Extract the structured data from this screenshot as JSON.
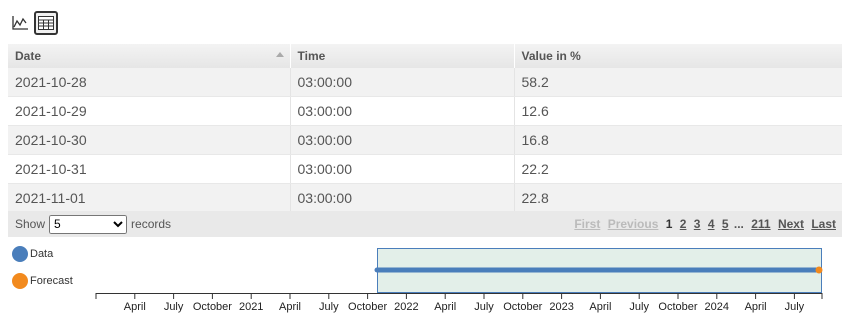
{
  "toolbar": {
    "chart_icon": "line-chart-icon",
    "table_icon": "table-icon"
  },
  "table": {
    "columns": [
      "Date",
      "Time",
      "Value in %"
    ],
    "rows": [
      [
        "2021-10-28",
        "03:00:00",
        "58.2"
      ],
      [
        "2021-10-29",
        "03:00:00",
        "12.6"
      ],
      [
        "2021-10-30",
        "03:00:00",
        "16.8"
      ],
      [
        "2021-10-31",
        "03:00:00",
        "22.2"
      ],
      [
        "2021-11-01",
        "03:00:00",
        "22.8"
      ]
    ]
  },
  "pager": {
    "show_label": "Show",
    "records_label": "records",
    "page_size": "5",
    "first": "First",
    "previous": "Previous",
    "pages": [
      "1",
      "2",
      "3",
      "4",
      "5"
    ],
    "ellipsis": "...",
    "last_page": "211",
    "next": "Next",
    "last": "Last"
  },
  "legend": {
    "data_label": "Data",
    "forecast_label": "Forecast",
    "data_color": "#4a7ebb",
    "forecast_color": "#f28a1e"
  },
  "timeline": {
    "tick_labels": [
      "April",
      "July",
      "October",
      "2021",
      "April",
      "July",
      "October",
      "2022",
      "April",
      "July",
      "October",
      "2023",
      "April",
      "July",
      "October",
      "2024",
      "April",
      "July"
    ],
    "selection_color": "#e3efe9",
    "selection_border": "#4a7ebb"
  }
}
